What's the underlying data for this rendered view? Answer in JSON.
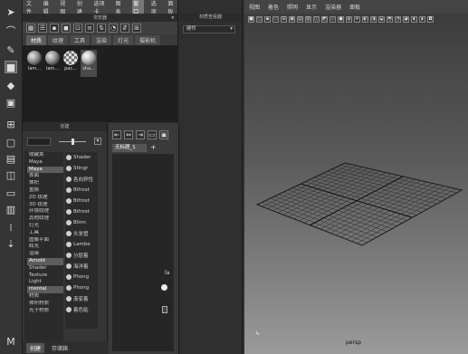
{
  "colors": {
    "bg": "#2f2f2f",
    "panel": "#3a3a3a",
    "accent": "#5d5d5d"
  },
  "hypershade": {
    "menu": [
      "文件",
      "编辑",
      "视图",
      "创建",
      "选项卡",
      "图表",
      "窗口",
      "选项",
      "面板"
    ],
    "title": "浏览器",
    "tabs": [
      "材质",
      "纹理",
      "工具",
      "渲染",
      "灯光",
      "摄影机"
    ],
    "swatches": [
      "lam...",
      "lam...",
      "pac...",
      "sha..."
    ]
  },
  "create": {
    "title": "创建",
    "categories": [
      "收藏夹",
      "Maya",
      "Maya",
      "表面",
      "体积",
      "置换",
      "2D 纹理",
      "3D 纹理",
      "环境纹理",
      "其他纹理",
      "灯光",
      "工具",
      "图像平面",
      "辉光",
      "渲染",
      "Arnold",
      "Shader",
      "Texture",
      "Light",
      "mental",
      "材质",
      "体积材质",
      "光子材质"
    ],
    "nodes": [
      "Shader",
      "Stingr",
      "各向异性",
      "Bifrost",
      "Bifrost",
      "Bifrost",
      "Blinn",
      "头发管",
      "Lambe",
      "分层着",
      "海洋着",
      "Phong",
      "Phong",
      "渐变着",
      "着色贴"
    ],
    "bottom_tabs": [
      "创建",
      "存储箱"
    ]
  },
  "node_editor": {
    "tab": "无标题_1",
    "add": "+",
    "port_label": "la"
  },
  "attr_editor": {
    "title": "材质查看器",
    "dropdown": "硬件"
  },
  "viewport": {
    "menu": [
      "视图",
      "着色",
      "照明",
      "显示",
      "渲染器",
      "面板"
    ],
    "camera": "persp"
  }
}
